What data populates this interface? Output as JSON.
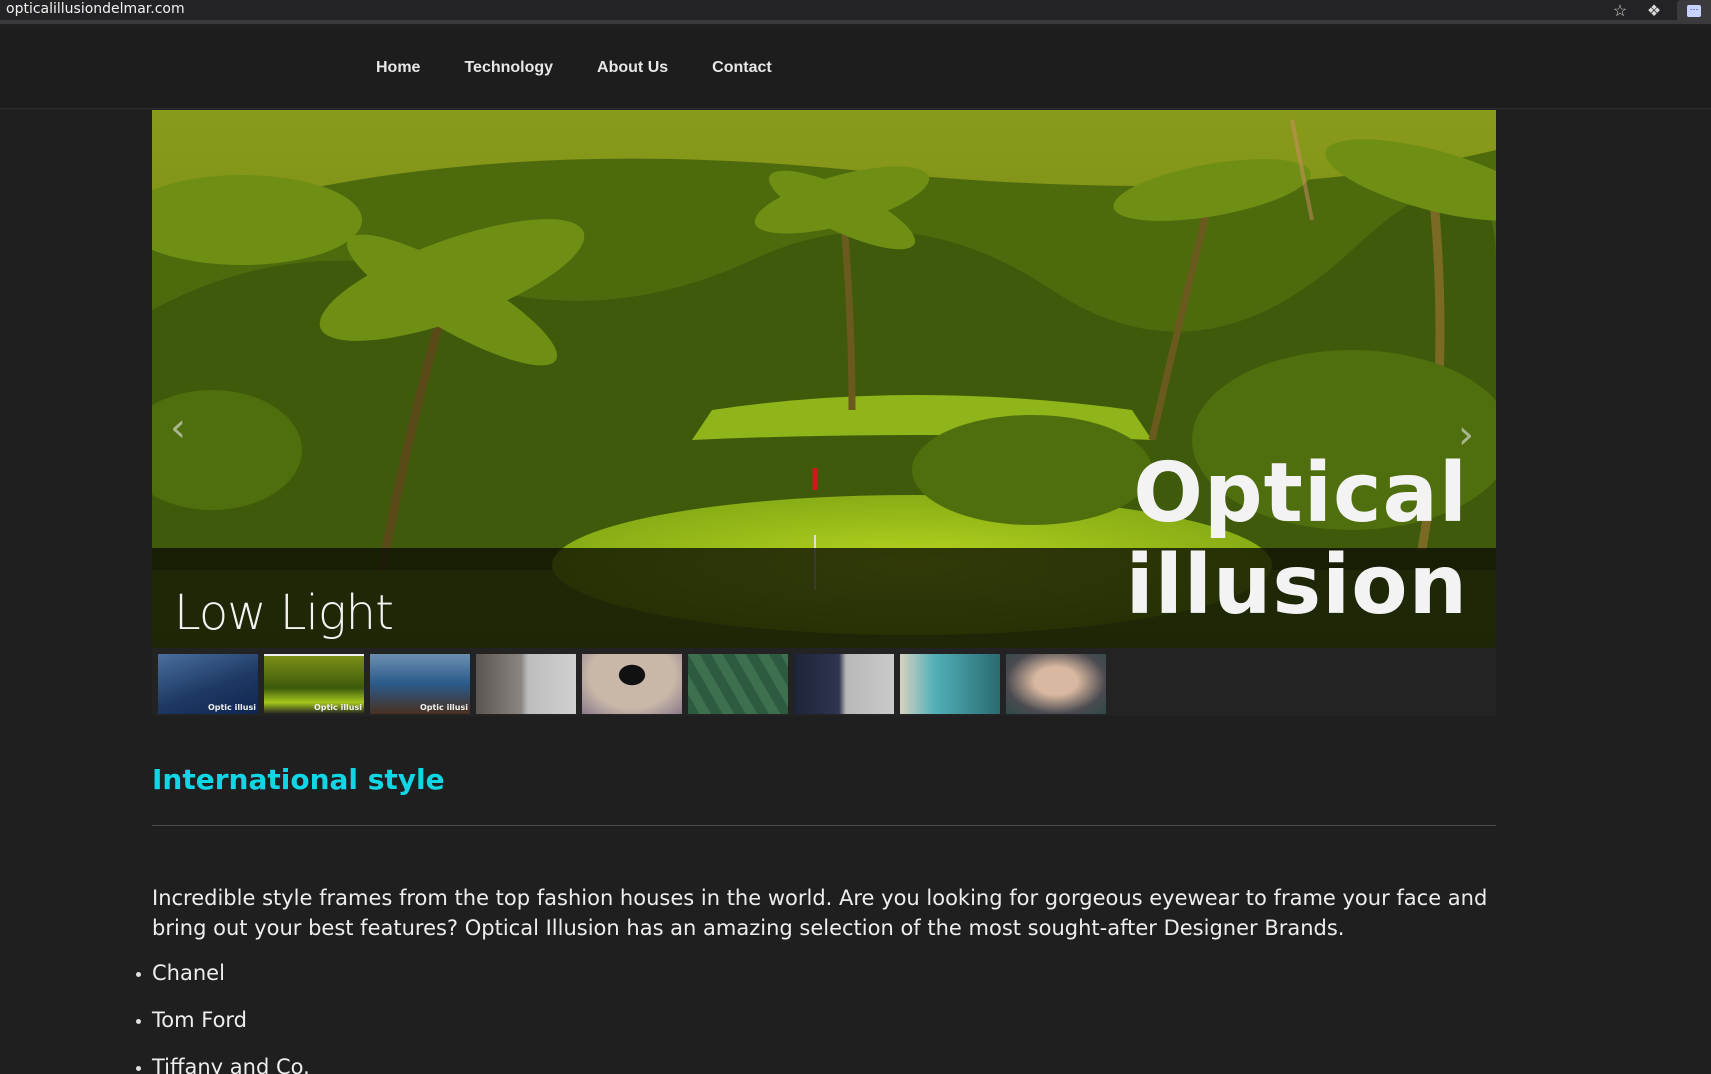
{
  "browser": {
    "url": "opticalillusiondelmar.com",
    "icons": [
      "star-icon",
      "dropbox-icon",
      "extension-icon"
    ]
  },
  "nav": {
    "items": [
      {
        "label": "Home"
      },
      {
        "label": "Technology"
      },
      {
        "label": "About Us"
      },
      {
        "label": "Contact"
      }
    ]
  },
  "slider": {
    "caption": "Low Light",
    "logo_line1": "Optical",
    "logo_line2": "illusion",
    "prev_label": "‹",
    "next_label": "›",
    "thumbnails": [
      {
        "name": "thumb-boat",
        "tag": "Optic illusi",
        "active": false
      },
      {
        "name": "thumb-golf",
        "tag": "Optic illusi",
        "active": true
      },
      {
        "name": "thumb-sea",
        "tag": "Optic illusi",
        "active": false
      },
      {
        "name": "thumb-couple",
        "tag": "",
        "active": false
      },
      {
        "name": "thumb-sunglasses",
        "tag": "",
        "active": false
      },
      {
        "name": "thumb-leaf-glasses",
        "tag": "",
        "active": false
      },
      {
        "name": "thumb-man-hat",
        "tag": "",
        "active": false
      },
      {
        "name": "thumb-tiffany",
        "tag": "",
        "active": false
      },
      {
        "name": "thumb-model-glasses",
        "tag": "",
        "active": false
      }
    ]
  },
  "content": {
    "title": "International style",
    "intro": "Incredible style frames from the top fashion houses in the world. Are you looking for gorgeous eyewear to frame your face and bring out your best features? Optical Illusion has an amazing selection of the most sought-after Designer Brands.",
    "brands": [
      "Chanel",
      "Tom Ford",
      "Tiffany and Co."
    ]
  },
  "colors": {
    "background": "#1f1f1f",
    "accent": "#11d6e6",
    "text": "#ededed"
  }
}
